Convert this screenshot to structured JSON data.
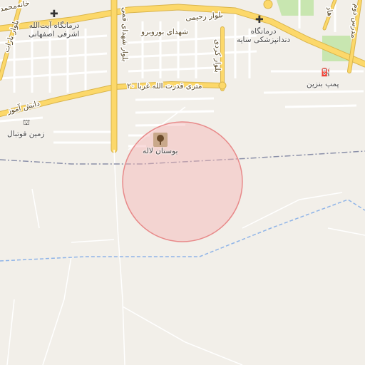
{
  "map": {
    "colors": {
      "land": "#f2efe9",
      "major_road": "#fcd86a",
      "major_road_casing": "#d9b44a",
      "minor_road": "#ffffff",
      "minor_road_casing": "#d6d2c8",
      "park": "#c8e6b0",
      "highlight_fill": "#f4b4b4",
      "highlight_stroke": "#e88a8a",
      "boundary": "#8a8fa8",
      "waterway": "#8fb4e8"
    },
    "roads": {
      "north_boulevard": "بلوار رحیمی",
      "shohada_boroujerd": "شهدای بوروبرو",
      "bahar_boulevard": "بلوار شهدای قمی",
      "ghodrat_road": "۲۰ متری قدرت الله غربا",
      "danesh_road": "دانش آموز",
      "left_vertical_road": "بلوار بارات",
      "right_top_road": "بلوار کردی",
      "far_right_road": "مدرس دوم",
      "top_right_label": "هاد",
      "top_left_label": "خانه‌محمد"
    },
    "places": {
      "clinic_left_line1": "درمانگاه آیت‌الله",
      "clinic_left_line2": "اشرفی اصفهانی",
      "clinic_right_line1": "درمانگاه",
      "clinic_right_line2": "دندانپزشکی سایه",
      "gas_station": "پمپ بنزین",
      "football_field": "زمین فوتبال",
      "park": "بوستان لاله"
    },
    "icons": {
      "clinic_left": "medical-cross-icon",
      "clinic_right": "medical-cross-icon",
      "gas_station": "fuel-pump-icon",
      "football_field": "sports-field-icon",
      "park": "park-tree-icon"
    },
    "glyphs": {
      "clinic": "✚",
      "gas_station": "⛽",
      "football": "⛫"
    }
  }
}
